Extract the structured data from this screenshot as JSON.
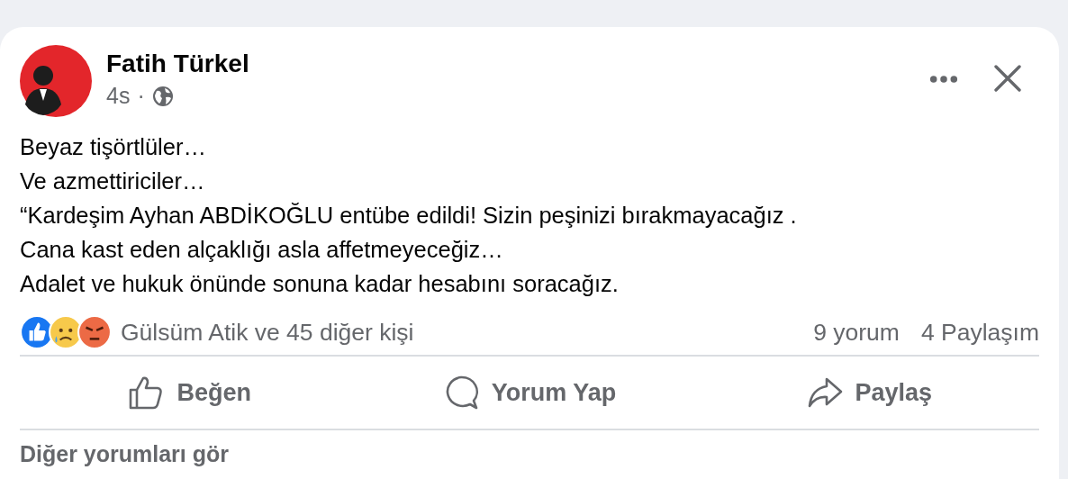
{
  "post": {
    "author": "Fatih Türkel",
    "time": "4s",
    "separator": "·",
    "lines": [
      "Beyaz tişörtlüler…",
      "Ve azmettiriciler…",
      "“Kardeşim Ayhan ABDİKOĞLU entübe edildi! Sizin peşinizi bırakmayacağız .",
      "Cana kast eden alçaklığı asla affetmeyeceğiz…",
      "Adalet ve hukuk önünde sonuna kadar hesabını soracağız."
    ],
    "reactions": [
      {
        "kind": "like"
      },
      {
        "kind": "sad"
      },
      {
        "kind": "angry"
      }
    ],
    "reactors": "Gülsüm Atik ve 45 diğer kişi",
    "comments": "9 yorum",
    "shares": "4 Paylaşım",
    "actions": [
      {
        "kind": "like",
        "label": "Beğen"
      },
      {
        "kind": "comment",
        "label": "Yorum Yap"
      },
      {
        "kind": "share",
        "label": "Paylaş"
      }
    ],
    "more_comments": "Diğer yorumları gör"
  }
}
